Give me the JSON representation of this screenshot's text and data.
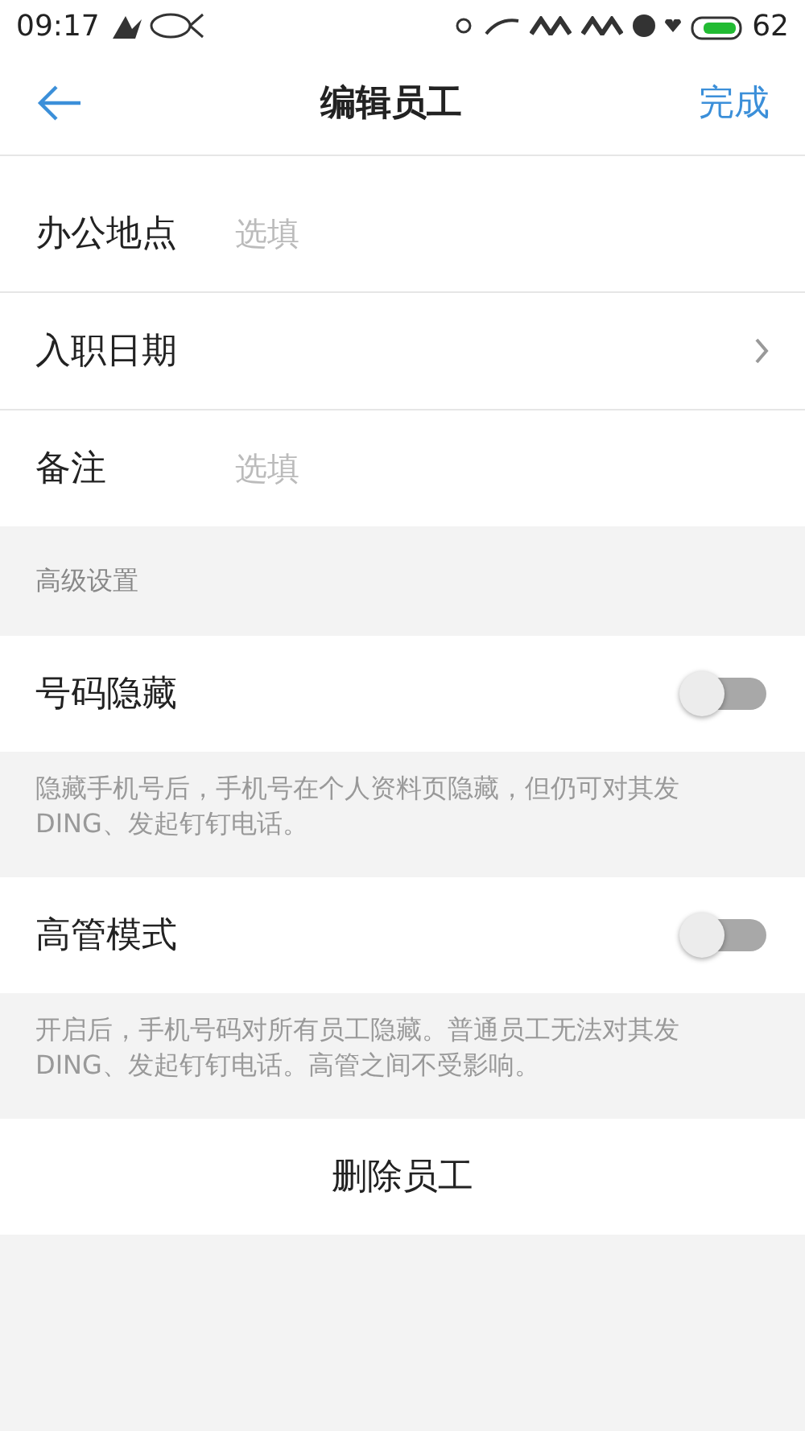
{
  "status_bar": {
    "time": "09:17",
    "battery": "62"
  },
  "header": {
    "title": "编辑员工",
    "action": "完成"
  },
  "fields": [
    {
      "kind": "input",
      "label": "办公地点",
      "placeholder": "选填"
    },
    {
      "kind": "link",
      "label": "入职日期"
    },
    {
      "kind": "input",
      "label": "备注",
      "placeholder": "选填"
    }
  ],
  "advanced": {
    "heading": "高级设置",
    "settings": [
      {
        "label": "号码隐藏",
        "on": false,
        "description": "隐藏手机号后，手机号在个人资料页隐藏，但仍可对其发DING、发起钉钉电话。"
      },
      {
        "label": "高管模式",
        "on": false,
        "description": "开启后，手机号码对所有员工隐藏。普通员工无法对其发DING、发起钉钉电话。高管之间不受影响。"
      }
    ]
  },
  "delete_button": "删除员工"
}
